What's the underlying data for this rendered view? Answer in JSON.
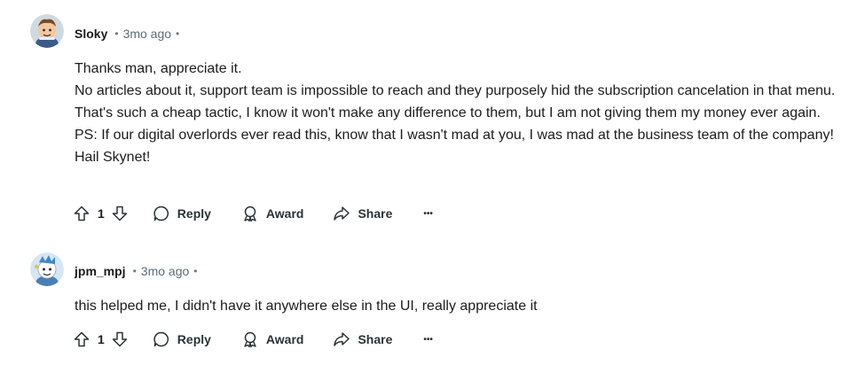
{
  "comments": [
    {
      "username": "Sloky",
      "time": "3mo ago",
      "dot": "•",
      "paragraphs": [
        "Thanks man, appreciate it.",
        "No articles about it, support team is impossible to reach and they purposely hid the subscription cancelation in that menu. That's such a cheap tactic, I know it won't make any difference to them, but I am not giving them my money ever again.",
        "PS: If our digital overlords ever read this, know that I wasn't mad at you, I was mad at the business team of the company! Hail Skynet!"
      ],
      "votes": "1",
      "reply_label": "Reply",
      "award_label": "Award",
      "share_label": "Share",
      "more_label": "•••"
    },
    {
      "username": "jpm_mpj",
      "time": "3mo ago",
      "dot": "•",
      "paragraphs": [
        "this helped me, I didn't have it anywhere else in the UI, really appreciate it"
      ],
      "votes": "1",
      "reply_label": "Reply",
      "award_label": "Award",
      "share_label": "Share",
      "more_label": "•••"
    }
  ],
  "icons": {
    "upvote": "upvote-icon",
    "downvote": "downvote-icon",
    "reply": "reply-bubble-icon",
    "award": "award-icon",
    "share": "share-icon",
    "more": "more-options-icon"
  },
  "colors": {
    "text": "#1c1c1c",
    "meta": "#5c6c74",
    "action": "#2a3236"
  }
}
